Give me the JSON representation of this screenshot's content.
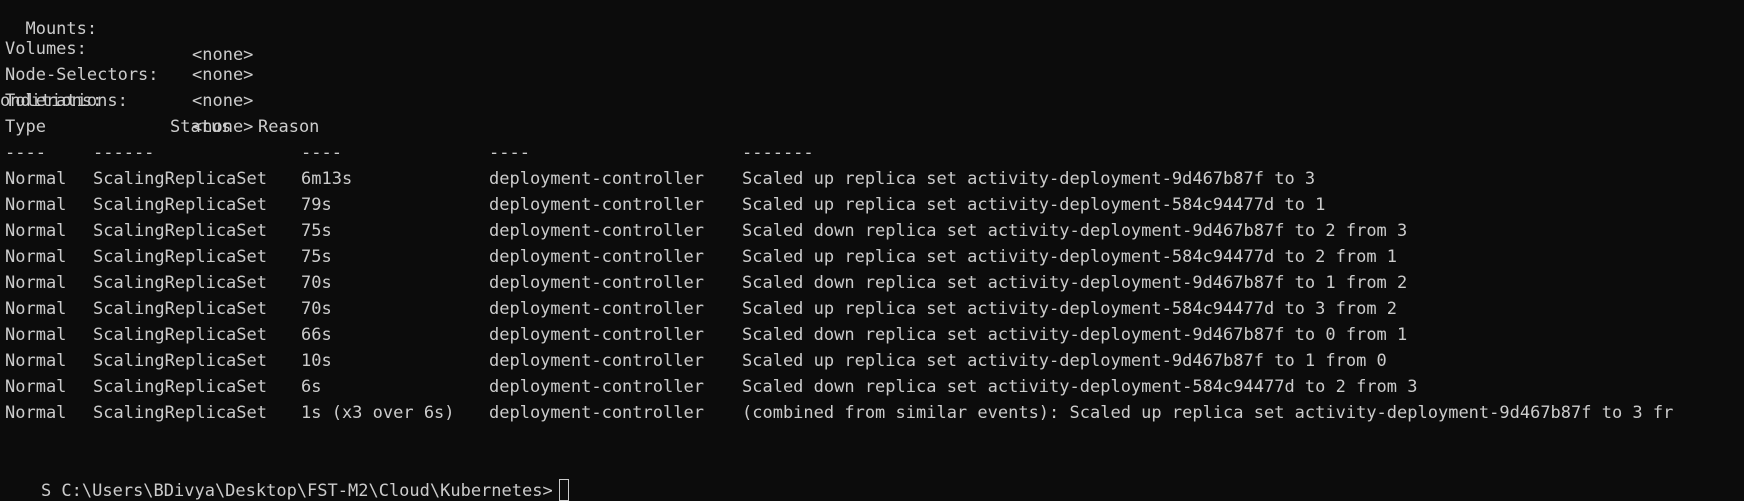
{
  "terminal": {
    "pod_template_fields": [
      {
        "key": "  Mounts:",
        "value": "<none>"
      },
      {
        "key": "Volumes:",
        "value": "<none>"
      },
      {
        "key": "Node-Selectors:",
        "value": "<none>"
      },
      {
        "key": "Tolerations:",
        "value": "<none>"
      }
    ],
    "conditions_label": "onditions:",
    "events_header": {
      "type": "Type",
      "status": "Status",
      "reason": "Reason"
    },
    "events_separators": {
      "type": "----",
      "reason": "------",
      "age": "----",
      "from": "----",
      "message": "-------"
    },
    "events": [
      {
        "type": "Normal",
        "reason": "ScalingReplicaSet",
        "age": "6m13s",
        "from": "deployment-controller",
        "message": "Scaled up replica set activity-deployment-9d467b87f to 3"
      },
      {
        "type": "Normal",
        "reason": "ScalingReplicaSet",
        "age": "79s",
        "from": "deployment-controller",
        "message": "Scaled up replica set activity-deployment-584c94477d to 1"
      },
      {
        "type": "Normal",
        "reason": "ScalingReplicaSet",
        "age": "75s",
        "from": "deployment-controller",
        "message": "Scaled down replica set activity-deployment-9d467b87f to 2 from 3"
      },
      {
        "type": "Normal",
        "reason": "ScalingReplicaSet",
        "age": "75s",
        "from": "deployment-controller",
        "message": "Scaled up replica set activity-deployment-584c94477d to 2 from 1"
      },
      {
        "type": "Normal",
        "reason": "ScalingReplicaSet",
        "age": "70s",
        "from": "deployment-controller",
        "message": "Scaled down replica set activity-deployment-9d467b87f to 1 from 2"
      },
      {
        "type": "Normal",
        "reason": "ScalingReplicaSet",
        "age": "70s",
        "from": "deployment-controller",
        "message": "Scaled up replica set activity-deployment-584c94477d to 3 from 2"
      },
      {
        "type": "Normal",
        "reason": "ScalingReplicaSet",
        "age": "66s",
        "from": "deployment-controller",
        "message": "Scaled down replica set activity-deployment-9d467b87f to 0 from 1"
      },
      {
        "type": "Normal",
        "reason": "ScalingReplicaSet",
        "age": "10s",
        "from": "deployment-controller",
        "message": "Scaled up replica set activity-deployment-9d467b87f to 1 from 0"
      },
      {
        "type": "Normal",
        "reason": "ScalingReplicaSet",
        "age": "6s",
        "from": "deployment-controller",
        "message": "Scaled down replica set activity-deployment-584c94477d to 2 from 3"
      },
      {
        "type": "Normal",
        "reason": "ScalingReplicaSet",
        "age": "1s (x3 over 6s)",
        "from": "deployment-controller",
        "message": "(combined from similar events): Scaled up replica set activity-deployment-9d467b87f to 3 fr"
      }
    ],
    "prompt": "S C:\\Users\\BDivya\\Desktop\\FST-M2\\Cloud\\Kubernetes>",
    "colors": {
      "background": "#0c0c0c",
      "foreground": "#cccccc"
    }
  }
}
